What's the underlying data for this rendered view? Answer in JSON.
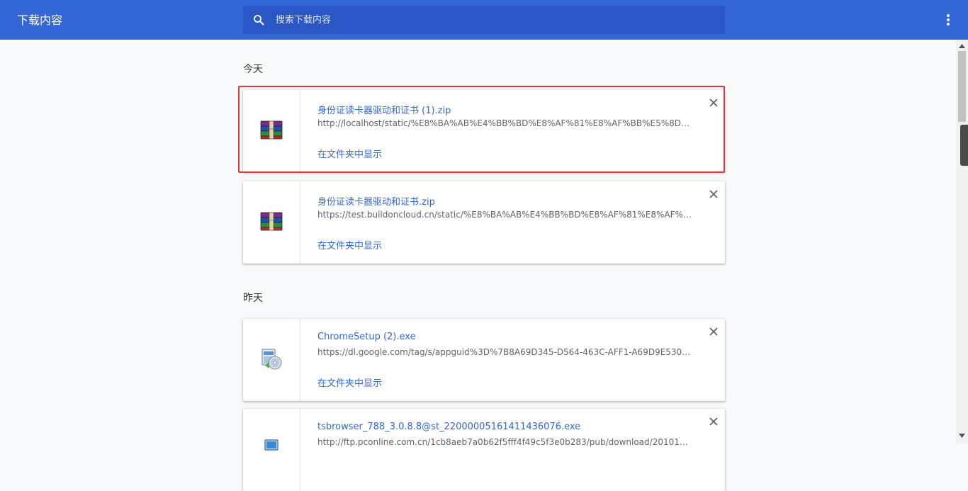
{
  "header": {
    "title": "下载内容",
    "search_placeholder": "搜索下载内容"
  },
  "sections": [
    {
      "label": "今天"
    },
    {
      "label": "昨天"
    }
  ],
  "downloads": [
    {
      "icon": "winrar-archive-icon",
      "name": "身份证读卡器驱动和证书 (1).zip",
      "url": "http://localhost/static/%E8%BA%AB%E4%BB%BD%E8%AF%81%E8%AF%BB%E5%8D%A1%...",
      "action": "在文件夹中显示",
      "highlighted": true
    },
    {
      "icon": "winrar-archive-icon",
      "name": "身份证读卡器驱动和证书.zip",
      "url": "https://test.buildoncloud.cn/static/%E8%BA%AB%E4%BB%BD%E8%AF%81%E8%AF%BB%...",
      "action": "在文件夹中显示"
    },
    {
      "icon": "installer-exe-icon",
      "name": "ChromeSetup (2).exe",
      "url": "https://dl.google.com/tag/s/appguid%3D%7B8A69D345-D564-463C-AFF1-A69D9E530F9...",
      "action": "在文件夹中显示"
    },
    {
      "icon": "exe-file-icon",
      "name": "tsbrowser_788_3.0.8.8@st_22000005161411436076.exe",
      "url": "http://ftp.pconline.com.cn/1cb8aeb7a0b62f5fff4f49c5f3e0b283/pub/download/201010/..."
    }
  ],
  "colors": {
    "toolbar": "#3367d6",
    "search_bg": "#2a56c6",
    "link": "#3367d6",
    "highlight_border": "#e53935"
  }
}
